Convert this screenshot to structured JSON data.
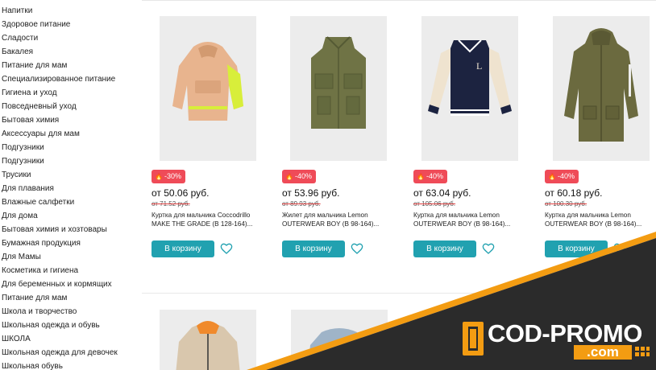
{
  "sidebar": {
    "items": [
      "Напитки",
      "Здоровое питание",
      "Сладости",
      "Бакалея",
      "Питание для мам",
      "Специализированное питание",
      "Гигиена и уход",
      "Повседневный уход",
      "Бытовая химия",
      "Аксессуары для мам",
      "Подгузники",
      "Подгузники",
      "Трусики",
      "Для плавания",
      "Влажные салфетки",
      "Для дома",
      "Бытовая химия и хозтовары",
      "Бумажная продукция",
      "Для Мамы",
      "Косметика и гигиена",
      "Для беременных и кормящих",
      "Питание для мам",
      "Школа и творчество",
      "Школьная одежда и обувь",
      "ШКОЛА",
      "Школьная одежда для девочек",
      "Школьная обувь"
    ]
  },
  "products": [
    {
      "discount": "-30%",
      "price": "от 50.06 руб.",
      "old_price": "от 71.52 руб.",
      "title": "Куртка для мальчика Coccodrillo MAKE THE GRADE (B 128-164)...",
      "cart_label": "В корзину",
      "image_icon": "jacket-peach-icon",
      "color": "#e8b48e"
    },
    {
      "discount": "-40%",
      "price": "от 53.96 руб.",
      "old_price": "от 89.93 руб.",
      "title": "Жилет для мальчика Lemon OUTERWEAR BOY (B 98-164)...",
      "cart_label": "В корзину",
      "image_icon": "vest-olive-icon",
      "color": "#6f7345"
    },
    {
      "discount": "-40%",
      "price": "от 63.04 руб.",
      "old_price": "от 105.06 руб.",
      "title": "Куртка для мальчика Lemon OUTERWEAR BOY (B 98-164)...",
      "cart_label": "В корзину",
      "image_icon": "bomber-jacket-icon",
      "color": "#1c2340"
    },
    {
      "discount": "-40%",
      "price": "от 60.18 руб.",
      "old_price": "от 100.30 руб.",
      "title": "Куртка для мальчика Lemon OUTERWEAR BOY (B 98-164)...",
      "cart_label": "В корзину",
      "image_icon": "parka-olive-icon",
      "color": "#6b6a3f"
    }
  ],
  "promo": {
    "brand": "COD-PROMO",
    "domain": ".com",
    "accent_color": "#f39c12",
    "dark_color": "#2b2b2b"
  },
  "colors": {
    "button": "#21a1b0",
    "badge": "#ef4b58"
  }
}
